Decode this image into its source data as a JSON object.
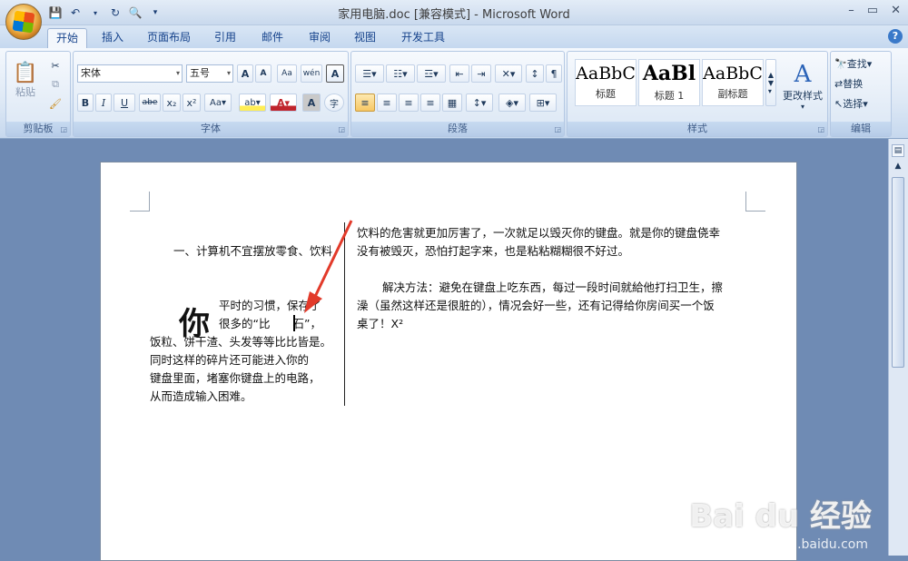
{
  "window": {
    "title": "家用电脑.doc [兼容模式] - Microsoft Word",
    "minimize": "–",
    "restore": "▭",
    "close": "✕"
  },
  "tabs": [
    "开始",
    "插入",
    "页面布局",
    "引用",
    "邮件",
    "审阅",
    "视图",
    "开发工具"
  ],
  "ribbon": {
    "clipboard": {
      "label": "剪贴板",
      "paste": "粘贴"
    },
    "font": {
      "label": "字体",
      "font_name": "宋体",
      "font_size": "五号",
      "grow": "A",
      "shrink": "A",
      "aa": "Aa",
      "ruby": "wén",
      "border": "A",
      "bold": "B",
      "italic": "I",
      "underline": "U",
      "strike": "abe",
      "sub": "x₂",
      "sup": "x²",
      "highlight": "ab",
      "color": "A",
      "shade": "A",
      "circle": "字"
    },
    "paragraph": {
      "label": "段落"
    },
    "styles": {
      "label": "样式",
      "items": [
        {
          "sample": "AaBbC",
          "name": "标题"
        },
        {
          "sample": "AaBl",
          "name": "标题 1"
        },
        {
          "sample": "AaBbC",
          "name": "副标题"
        }
      ],
      "change_styles": "更改样式"
    },
    "editing": {
      "label": "编辑",
      "find": "查找",
      "replace": "替换",
      "select": "选择"
    }
  },
  "document": {
    "left_heading": "一、计算机不宜摆放零食、饮料",
    "dropcap": "你",
    "left_lines": [
      "平时的习惯，保存了",
      "很多的“比　　石”，",
      "饭粒、饼干渣、头发等等比比皆是。",
      "同时这样的碎片还可能进入你的",
      "键盘里面，堵塞你键盘上的电路，",
      "从而造成输入困难。"
    ],
    "right_para1": [
      "饮料的危害就更加厉害了，一次就足以毁灭你的键盘。就是你的键盘侥幸",
      "没有被毁灭，恐怕打起字来，也是粘粘糊糊很不好过。"
    ],
    "right_para2": [
      "解决方法：避免在键盘上吃东西，每过一段时间就給他打扫卫生，擦",
      "澡（虽然这样还是很脏的），情况会好一些，还有记得给你房间买一个饭",
      "桌了！X²"
    ]
  },
  "watermark": {
    "logo": "Bai du 经验",
    "url": "jingyan.baidu.com"
  }
}
